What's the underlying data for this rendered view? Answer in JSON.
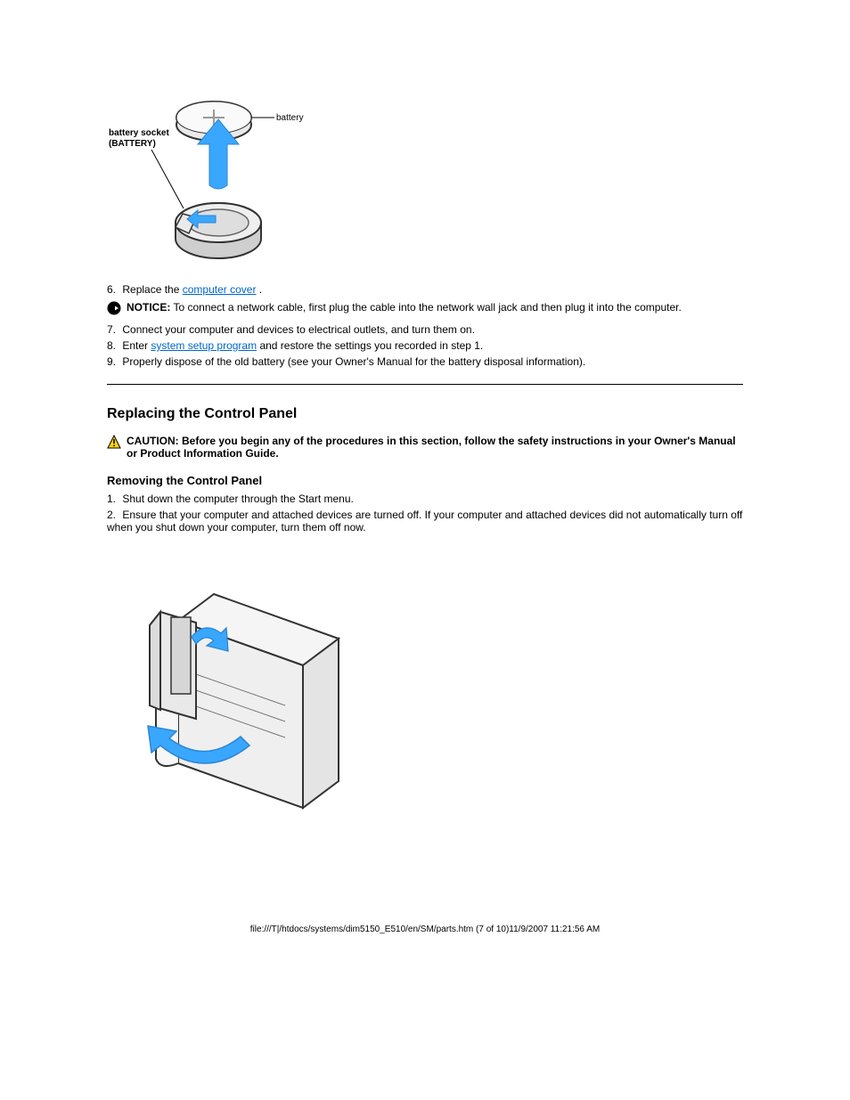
{
  "fig1": {
    "label_battery": "battery",
    "label_socket_line1": "battery socket",
    "label_socket_line2": "(BATTERY)"
  },
  "step6": {
    "num": "6.",
    "text_before_link": "Replace the ",
    "link": "computer cover",
    "text_after_link": "."
  },
  "notice": {
    "label": "NOTICE:",
    "text": " To connect a network cable, first plug the cable into the network wall jack and then plug it into the computer."
  },
  "step7": {
    "num": "7.",
    "text": "Connect your computer and devices to electrical outlets, and turn them on."
  },
  "step8": {
    "num": "8.",
    "text_before_link": "Enter ",
    "link": "system setup program",
    "text_after_link": " and restore the settings you recorded in step 1."
  },
  "step9": {
    "num": "9.",
    "text": "Properly dispose of the old battery (see your Owner's Manual for the battery disposal information)."
  },
  "section_title": "Replacing the Control Panel",
  "caution": {
    "label": "CAUTION:",
    "text": " Before you begin any of the procedures in this section, follow the safety instructions in your Owner's Manual or Product Information Guide."
  },
  "subhead": "Removing the Control Panel",
  "removal": {
    "step1": {
      "num": "1.",
      "text": "Shut down the computer through the Start menu."
    },
    "step2": {
      "num": "2.",
      "text": "Ensure that your computer and attached devices are turned off. If your computer and attached devices did not automatically turn off when you shut down your computer, turn them off now."
    }
  },
  "footer": {
    "url": "file:///T|/htdocs/systems/dim5150_E510/en/SM/parts.htm",
    "info": " (7 of 10)11/9/2007 11:21:56 AM"
  },
  "icons": {
    "notice": "notice-icon",
    "caution": "caution-icon"
  }
}
